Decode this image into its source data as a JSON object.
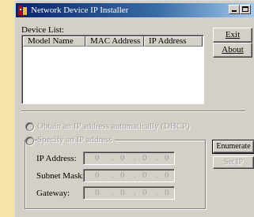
{
  "window": {
    "title": "Network Device IP Installer"
  },
  "device_list": {
    "label": "Device List:",
    "columns": [
      "Model Name",
      "MAC Address",
      "IP Address"
    ],
    "rows": []
  },
  "buttons": {
    "exit": "Exit",
    "about": "About",
    "enumerate": "Enumerate",
    "set_ip": "Set IP"
  },
  "options": {
    "dhcp_label": "Obtain an IP address automatically (DHCP)",
    "static_label": "Specify an IP address"
  },
  "fields": {
    "ip_address": {
      "label": "IP Address:",
      "octets": [
        "0",
        "0",
        "0",
        "0"
      ]
    },
    "subnet_mask": {
      "label": "Subnet Mask:",
      "octets": [
        "0",
        "0",
        "0",
        "0"
      ]
    },
    "gateway": {
      "label": "Gateway:",
      "octets": [
        "0",
        "0",
        "0",
        "0"
      ]
    }
  },
  "colors": {
    "title_bar_start": "#0a246a",
    "title_bar_end": "#a6caf0",
    "window_face": "#d4d0c8",
    "desktop": "#f6e4a6"
  }
}
